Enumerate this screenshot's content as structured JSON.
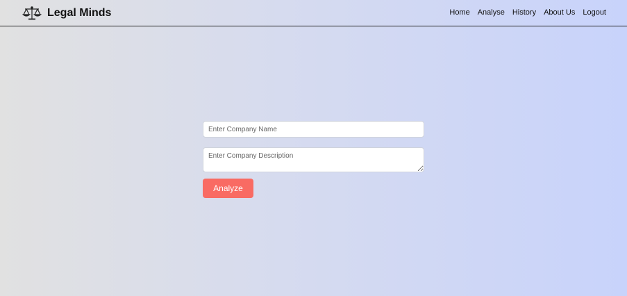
{
  "app": {
    "brand_name": "Legal Minds",
    "logo_icon": "scales-of-justice-icon"
  },
  "nav": {
    "items": [
      {
        "label": "Home"
      },
      {
        "label": "Analyse"
      },
      {
        "label": "History"
      },
      {
        "label": "About Us"
      },
      {
        "label": "Logout"
      }
    ]
  },
  "form": {
    "company_name_placeholder": "Enter Company Name",
    "company_name_value": "",
    "company_description_placeholder": "Enter Company Description",
    "company_description_value": "",
    "analyze_label": "Analyze"
  },
  "colors": {
    "accent_button": "#f96b63",
    "background_left": "#e1e1e1",
    "background_right": "#c8d3fb"
  }
}
